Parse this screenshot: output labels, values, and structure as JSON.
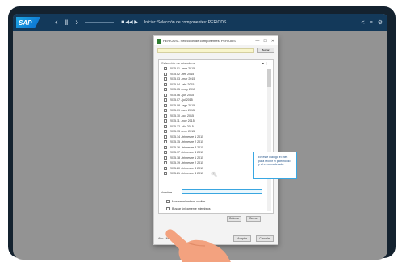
{
  "toolbar": {
    "logo": "SAP",
    "back_icon": "‹",
    "play_icon": "‖",
    "forward_icon": "›",
    "title": "Iniciar: Selección de componentes: PERIODS",
    "share_icon": "<",
    "menu_icon": "≡",
    "settings_icon": "⚙"
  },
  "dialog": {
    "title": "PERIODS - Selección de componentes: PERIODS",
    "minimize": "—",
    "maximize": "☐",
    "close": "✕",
    "search_button": "Buscar",
    "list_header": "Selección de miembros",
    "list_tools": "▾ ⋮",
    "periods": [
      "2015.01 - ene 2015",
      "2015.02 - feb 2015",
      "2015.03 - mar 2015",
      "2015.04 - abr 2015",
      "2015.05 - may 2015",
      "2015.06 - jun 2015",
      "2015.07 - jul 2015",
      "2015.08 - ago 2015",
      "2015.09 - sep 2015",
      "2015.10 - oct 2015",
      "2015.11 - nov 2015",
      "2015.12 - dic 2015",
      "2015.13 - ene 2015",
      "2015.14 - trimestre 1 2015",
      "2015.15 - trimestre 2 2015",
      "2015.16 - trimestre 3 2015",
      "2015.17 - trimestre 4 2015",
      "2015.18 - trimestre 1 2015",
      "2015.19 - trimestre 2 2015",
      "2015.20 - trimestre 3 2015",
      "2015.21 - trimestre 4 2015"
    ],
    "name_label": "Nombre",
    "option1": "Mostrar miembros ocultos",
    "option2": "Buscar únicamente miembros",
    "small_button1": "Ordenar",
    "small_button2": "Borrar",
    "footer_info": "Año - Mes - 2015",
    "ok_button": "Aceptar",
    "cancel_button": "Cancelar"
  },
  "callout": {
    "text": "En este diálogo el mes para recibir el patrimonio y el es considerado."
  },
  "colors": {
    "toolbar_bg": "#13395a",
    "accent": "#38a7e3",
    "screen_bg": "#939393"
  }
}
